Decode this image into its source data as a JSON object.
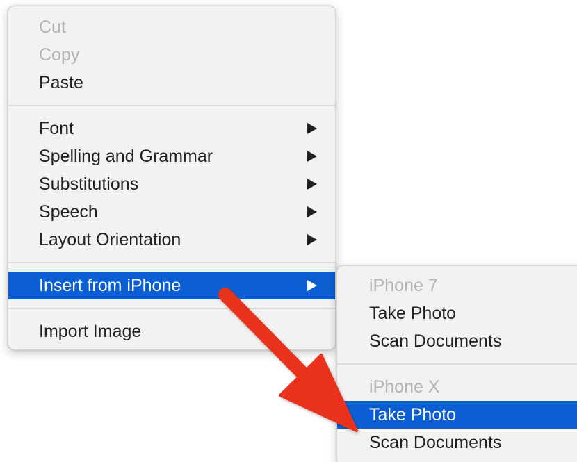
{
  "context_menu": {
    "items": [
      {
        "label": "Cut",
        "enabled": false
      },
      {
        "label": "Copy",
        "enabled": false
      },
      {
        "label": "Paste",
        "enabled": true
      },
      {
        "label": "Font",
        "has_submenu": true
      },
      {
        "label": "Spelling and Grammar",
        "has_submenu": true
      },
      {
        "label": "Substitutions",
        "has_submenu": true
      },
      {
        "label": "Speech",
        "has_submenu": true
      },
      {
        "label": "Layout Orientation",
        "has_submenu": true
      },
      {
        "label": "Insert from iPhone",
        "has_submenu": true,
        "highlighted": true
      },
      {
        "label": "Import Image",
        "enabled": true
      }
    ]
  },
  "submenu": {
    "groups": [
      {
        "device": "iPhone 7",
        "items": [
          {
            "label": "Take Photo"
          },
          {
            "label": "Scan Documents"
          }
        ]
      },
      {
        "device": "iPhone X",
        "items": [
          {
            "label": "Take Photo",
            "highlighted": true
          },
          {
            "label": "Scan Documents"
          }
        ]
      }
    ]
  },
  "colors": {
    "highlight": "#0b5fd3",
    "annotation_arrow": "#e8311f",
    "menu_background": "#f2f2f2"
  }
}
